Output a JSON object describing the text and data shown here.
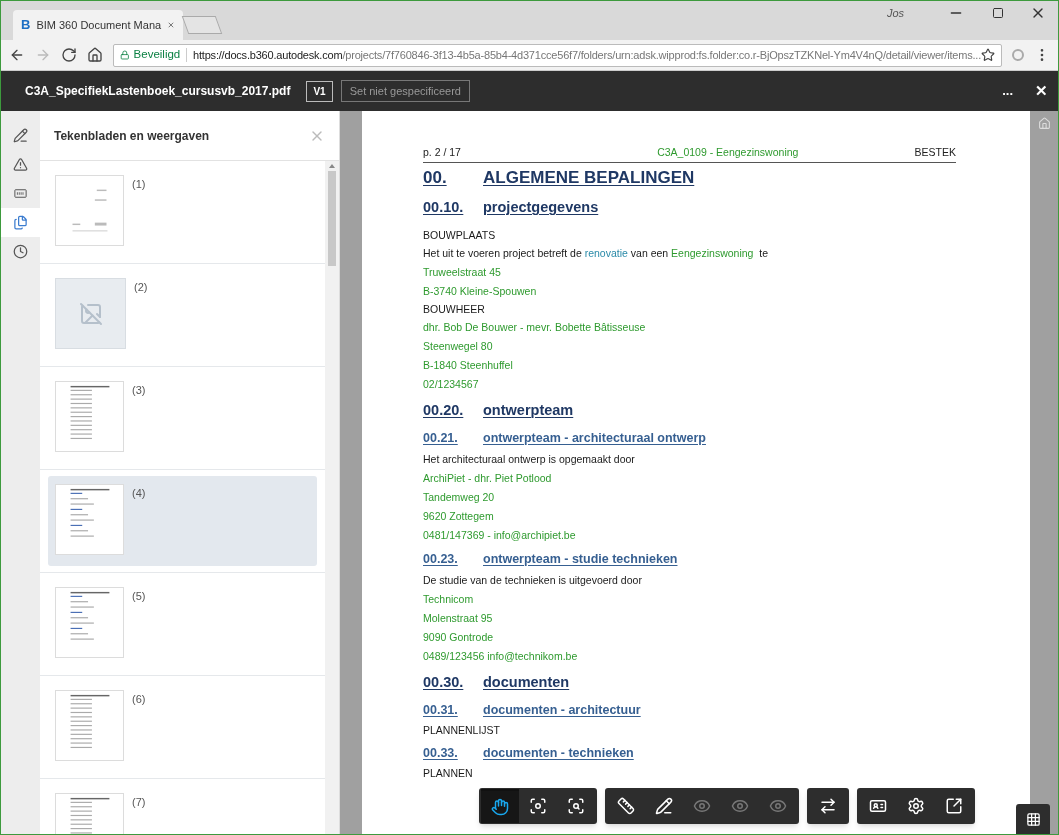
{
  "browser": {
    "tab": {
      "title": "BIM 360 Document Mana",
      "favicon": "B"
    },
    "user": "Jos",
    "security": "Beveiligd",
    "url_host": "https://docs.b360.autodesk.com",
    "url_path": "/projects/7f760846-3f13-4b5a-85b4-4d371cce56f7/folders/urn:adsk.wipprod:fs.folder:co.r-BjOpszTZKNel-Ym4V4nQ/detail/viewer/items..."
  },
  "header": {
    "file_name": "C3A_SpecifiekLastenboek_cursusvb_2017.pdf",
    "version": "V1",
    "set": "Set niet gespecificeerd",
    "more": "...",
    "close": "✕"
  },
  "side_tabs": [
    {
      "kind": "markup",
      "selected": false
    },
    {
      "kind": "issues",
      "selected": false
    },
    {
      "kind": "rfi",
      "selected": false
    },
    {
      "kind": "sheets",
      "selected": true
    },
    {
      "kind": "history",
      "selected": false
    }
  ],
  "panel": {
    "title": "Tekenbladen en weergaven",
    "items": [
      {
        "label": "(1)",
        "kind": "cover",
        "selected": false
      },
      {
        "label": "(2)",
        "kind": "missing",
        "selected": false
      },
      {
        "label": "(3)",
        "kind": "list",
        "selected": false
      },
      {
        "label": "(4)",
        "kind": "text",
        "selected": true
      },
      {
        "label": "(5)",
        "kind": "text",
        "selected": false
      },
      {
        "label": "(6)",
        "kind": "list",
        "selected": false
      },
      {
        "label": "(7)",
        "kind": "list",
        "selected": false
      }
    ]
  },
  "document": {
    "page": "p. 2 / 17",
    "project": "C3A_0109 - Eengezinswoning",
    "type": "BESTEK",
    "lines": [
      {
        "kind": "h1",
        "number": "00.",
        "title": "ALGEMENE BEPALINGEN"
      },
      {
        "kind": "h2",
        "number": "00.10.",
        "title": "projectgegevens"
      },
      {
        "kind": "label",
        "text": "BOUWPLAATS"
      },
      {
        "kind": "mixed",
        "parts": [
          {
            "kind": "plain",
            "text": "Het uit te voeren project betreft de "
          },
          {
            "kind": "link",
            "text": "renovatie"
          },
          {
            "kind": "plain",
            "text": " van een "
          },
          {
            "kind": "field",
            "text": "Eengezinswoning"
          },
          {
            "kind": "plain",
            "text": "  te"
          }
        ]
      },
      {
        "kind": "field",
        "text": "Truweelstraat 45"
      },
      {
        "kind": "field",
        "text": "B-3740  Kleine-Spouwen"
      },
      {
        "kind": "label",
        "text": "BOUWHEER"
      },
      {
        "kind": "field",
        "text": "dhr. Bob De Bouwer  -  mevr. Bobette Bâtisseuse"
      },
      {
        "kind": "field",
        "text": "Steenwegel 80"
      },
      {
        "kind": "field",
        "text": "B-1840  Steenhuffel"
      },
      {
        "kind": "field",
        "text": "02/1234567"
      },
      {
        "kind": "h2",
        "number": "00.20.",
        "title": "ontwerpteam"
      },
      {
        "kind": "h3",
        "number": "00.21.",
        "title": "ontwerpteam - architecturaal ontwerp"
      },
      {
        "kind": "plain",
        "text": "Het architecturaal ontwerp is opgemaakt door"
      },
      {
        "kind": "field",
        "text": "ArchiPiet - dhr. Piet Potlood"
      },
      {
        "kind": "field",
        "text": "Tandemweg 20"
      },
      {
        "kind": "field",
        "text": "9620  Zottegem"
      },
      {
        "kind": "field",
        "text": "0481/147369  -  info@archipiet.be"
      },
      {
        "kind": "h3",
        "number": "00.23.",
        "title": "ontwerpteam - studie technieken"
      },
      {
        "kind": "plain",
        "text": "De studie van de technieken is uitgevoerd door"
      },
      {
        "kind": "field",
        "text": "Technicom"
      },
      {
        "kind": "field",
        "text": "Molenstraat 95"
      },
      {
        "kind": "field",
        "text": "9090  Gontrode"
      },
      {
        "kind": "field",
        "text": "0489/123456     info@technikom.be"
      },
      {
        "kind": "h2",
        "number": "00.30.",
        "title": "documenten"
      },
      {
        "kind": "h3",
        "number": "00.31.",
        "title": "documenten - architectuur"
      },
      {
        "kind": "label",
        "text": "PLANNENLIJST"
      },
      {
        "kind": "h3",
        "number": "00.33.",
        "title": "documenten - technieken"
      },
      {
        "kind": "label",
        "text": "PLANNEN"
      }
    ]
  },
  "toolbar": [
    [
      {
        "kind": "pan",
        "selected": true,
        "disabled": false
      },
      {
        "kind": "focus",
        "selected": false,
        "disabled": false
      },
      {
        "kind": "zoom-window",
        "selected": false,
        "disabled": false
      }
    ],
    [
      {
        "kind": "measure",
        "selected": false,
        "disabled": false
      },
      {
        "kind": "markup",
        "selected": false,
        "disabled": false
      },
      {
        "kind": "eye-markup",
        "selected": false,
        "disabled": true
      },
      {
        "kind": "eye-issue",
        "selected": false,
        "disabled": true
      },
      {
        "kind": "eye-rfi",
        "selected": false,
        "disabled": true
      }
    ],
    [
      {
        "kind": "compare",
        "selected": false,
        "disabled": false
      }
    ],
    [
      {
        "kind": "properties",
        "selected": false,
        "disabled": false
      },
      {
        "kind": "settings",
        "selected": false,
        "disabled": false
      },
      {
        "kind": "fullscreen",
        "selected": false,
        "disabled": false
      }
    ]
  ]
}
